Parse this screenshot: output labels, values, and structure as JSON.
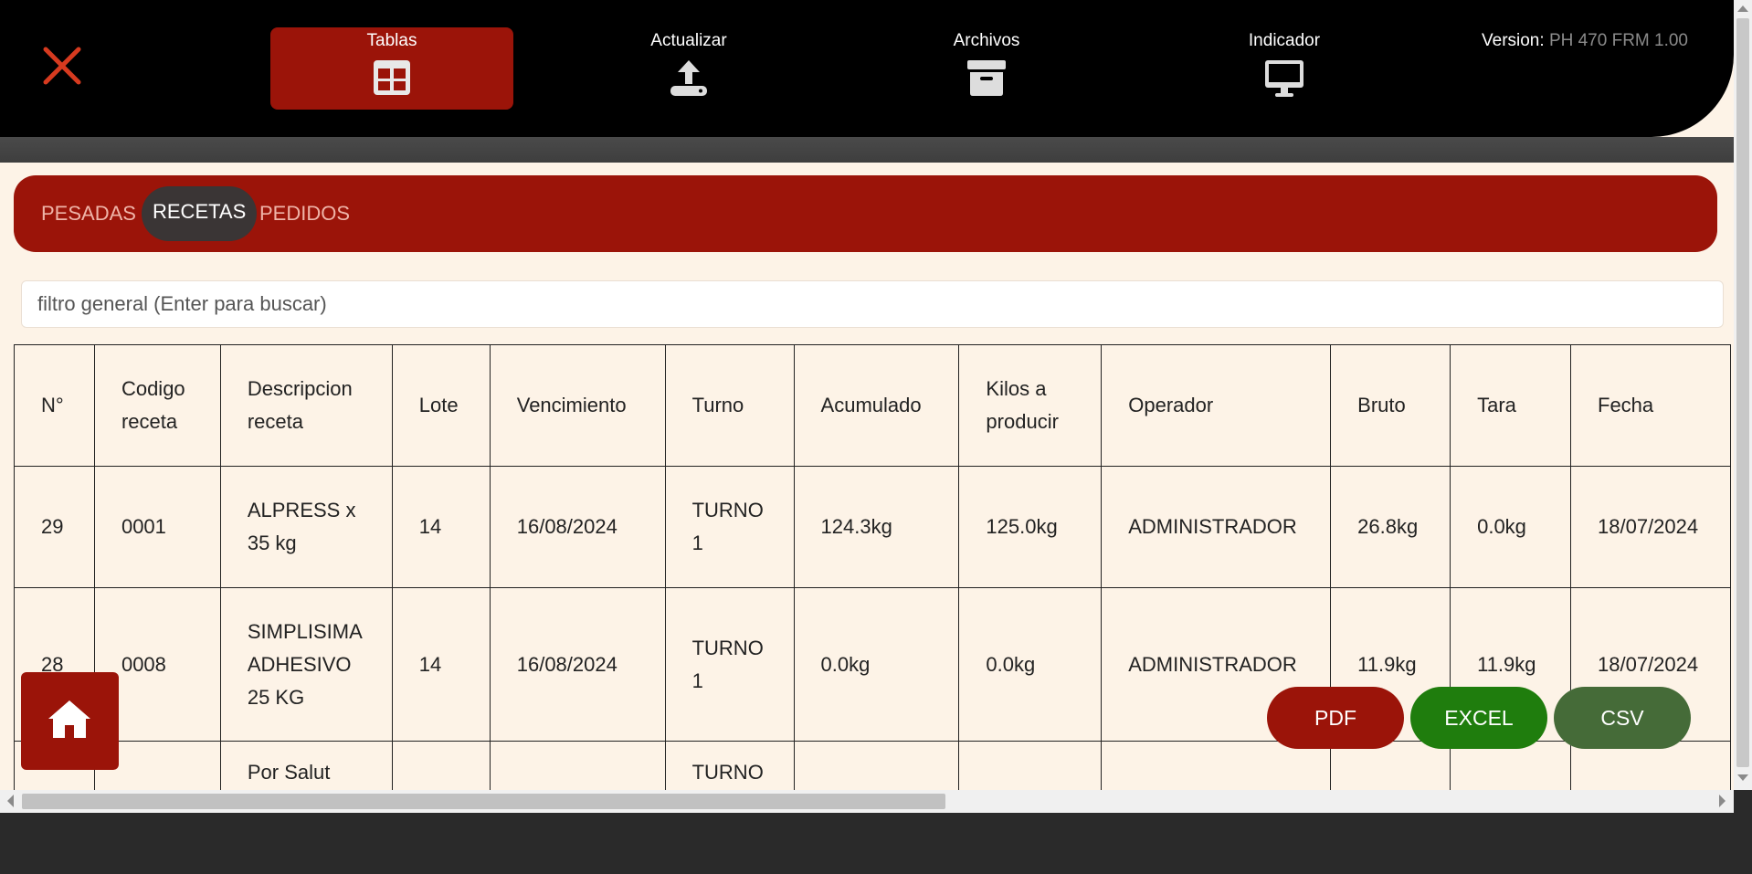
{
  "header": {
    "nav": [
      {
        "label": "Tablas",
        "icon": "table-icon",
        "active": true
      },
      {
        "label": "Actualizar",
        "icon": "upload-icon",
        "active": false
      },
      {
        "label": "Archivos",
        "icon": "archive-icon",
        "active": false
      },
      {
        "label": "Indicador",
        "icon": "monitor-icon",
        "active": false
      }
    ],
    "version_label": "Version:",
    "version_value": "PH 470 FRM 1.00",
    "close_icon": "close-icon"
  },
  "tabs": [
    {
      "label": "PESADAS",
      "active": false
    },
    {
      "label": "RECETAS",
      "active": true
    },
    {
      "label": "PEDIDOS",
      "active": false
    }
  ],
  "search": {
    "placeholder": "filtro general (Enter para buscar)",
    "value": ""
  },
  "table": {
    "columns": [
      "N°",
      "Codigo receta",
      "Descripcion receta",
      "Lote",
      "Vencimiento",
      "Turno",
      "Acumulado",
      "Kilos a producir",
      "Operador",
      "Bruto",
      "Tara",
      "Fecha"
    ],
    "rows": [
      [
        "29",
        "0001",
        "ALPRESS x 35 kg",
        "14",
        "16/08/2024",
        "TURNO 1",
        "124.3kg",
        "125.0kg",
        "ADMINISTRADOR",
        "26.8kg",
        "0.0kg",
        "18/07/2024"
      ],
      [
        "28",
        "0008",
        "SIMPLISIMA ADHESIVO 25 KG",
        "14",
        "16/08/2024",
        "TURNO 1",
        "0.0kg",
        "0.0kg",
        "ADMINISTRADOR",
        "11.9kg",
        "11.9kg",
        "18/07/2024"
      ],
      [
        "",
        "",
        "Por Salut",
        "",
        "",
        "TURNO",
        "",
        "",
        "",
        "",
        "",
        ""
      ]
    ]
  },
  "buttons": {
    "pdf": "PDF",
    "excel": "EXCEL",
    "csv": "CSV",
    "home_icon": "home-icon"
  },
  "colors": {
    "brand_red": "#9b1409",
    "excel_green": "#1f7d0d",
    "csv_green": "#456b38",
    "background": "#fdf3e7"
  }
}
